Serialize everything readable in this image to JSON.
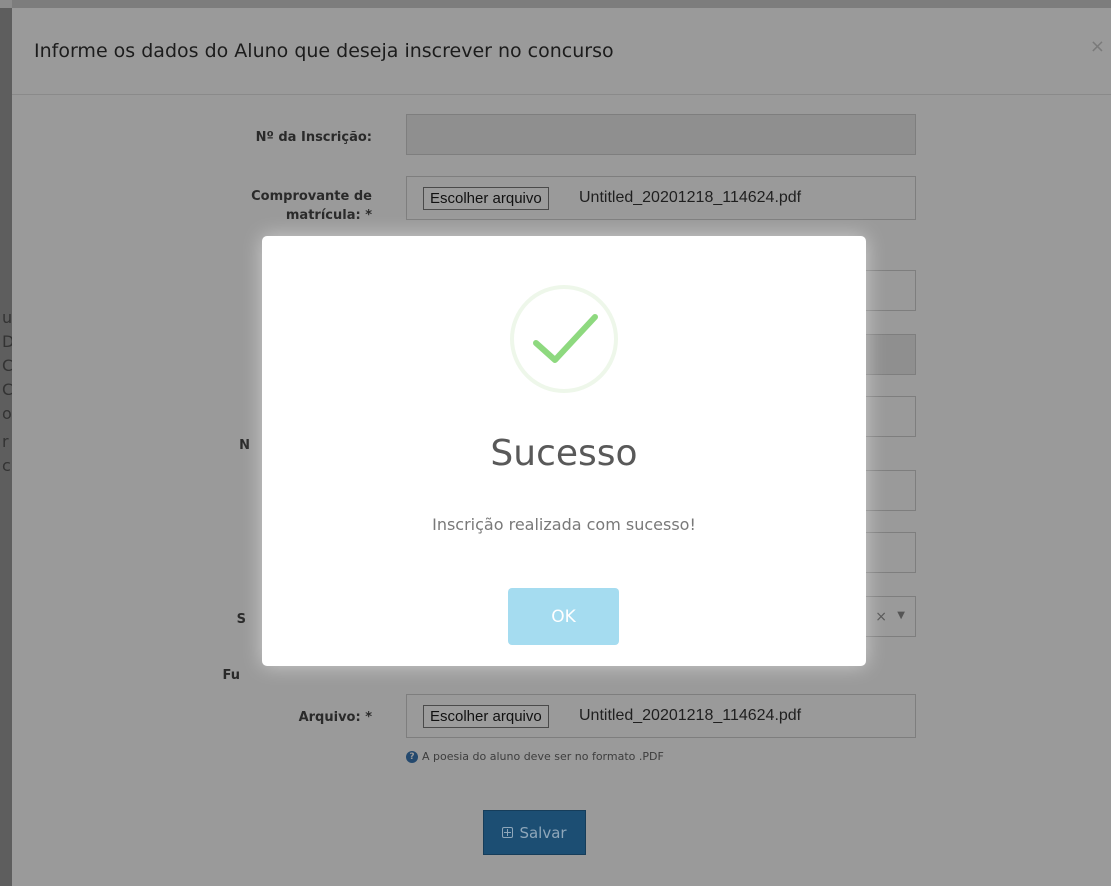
{
  "form_modal": {
    "title": "Informe os dados do Aluno que deseja inscrever no concurso",
    "close_symbol": "×",
    "fields": {
      "inscricao_label": "Nº da Inscrição:",
      "comprovante_label": "Comprovante de matrícula: *",
      "arquivo_label": "Arquivo: *"
    },
    "partial_labels": {
      "n_letter": "N",
      "s_letter": "S",
      "fu_letters": "Fu"
    },
    "file_button_label": "Escolher arquivo",
    "comprovante_file_name": "Untitled_20201218_114624.pdf",
    "arquivo_file_name": "Untitled_20201218_114624.pdf",
    "select_clear_symbol": "×",
    "select_caret_symbol": "▼",
    "arquivo_help": "A poesia do aluno deve ser no formato .PDF",
    "help_icon_glyph": "?",
    "save_label": "Salvar"
  },
  "alert": {
    "title": "Sucesso",
    "message": "Inscrição realizada com sucesso!",
    "ok_label": "OK",
    "icon": "success-check-icon",
    "colors": {
      "check": "#8ed97f",
      "ring": "#eef7ea",
      "ok_button": "#a5dcf0"
    }
  },
  "background_peek": {
    "letters": [
      "u",
      "D",
      "C",
      "C",
      "o",
      "r",
      "c"
    ]
  }
}
